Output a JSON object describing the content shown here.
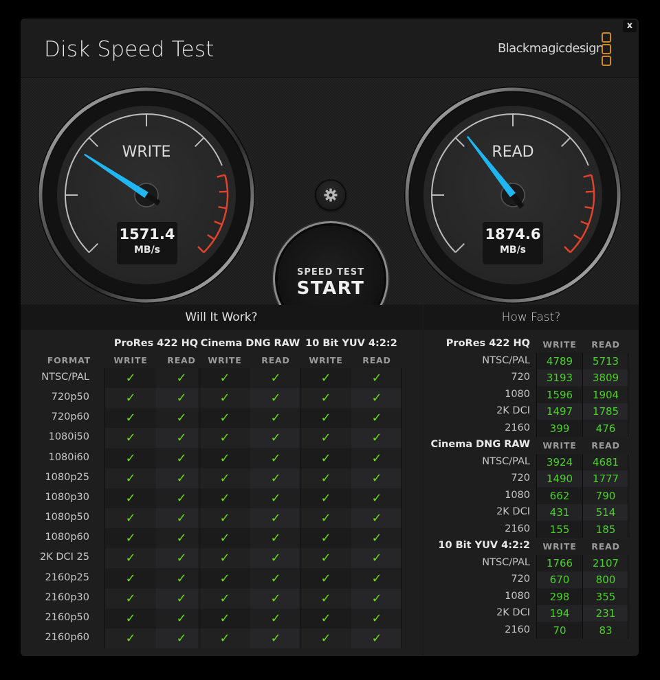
{
  "window": {
    "title": "Disk Speed Test",
    "brand": "Blackmagicdesign",
    "close_label": "x"
  },
  "gauges": {
    "write": {
      "label": "WRITE",
      "value": "1571.4",
      "unit": "MB/s",
      "needle_fraction": 0.29
    },
    "read": {
      "label": "READ",
      "value": "1874.6",
      "unit": "MB/s",
      "needle_fraction": 0.36
    }
  },
  "controls": {
    "settings_icon": "gear-icon",
    "start_line1": "SPEED TEST",
    "start_line2": "START"
  },
  "will_it_work": {
    "title": "Will It Work?",
    "format_header": "FORMAT",
    "codecs": [
      "ProRes 422 HQ",
      "Cinema DNG RAW",
      "10 Bit YUV 4:2:2"
    ],
    "subcols": [
      "WRITE",
      "READ"
    ],
    "check_glyph": "✓",
    "rows": [
      {
        "format": "NTSC/PAL",
        "results": [
          true,
          true,
          true,
          true,
          true,
          true
        ]
      },
      {
        "format": "720p50",
        "results": [
          true,
          true,
          true,
          true,
          true,
          true
        ]
      },
      {
        "format": "720p60",
        "results": [
          true,
          true,
          true,
          true,
          true,
          true
        ]
      },
      {
        "format": "1080i50",
        "results": [
          true,
          true,
          true,
          true,
          true,
          true
        ]
      },
      {
        "format": "1080i60",
        "results": [
          true,
          true,
          true,
          true,
          true,
          true
        ]
      },
      {
        "format": "1080p25",
        "results": [
          true,
          true,
          true,
          true,
          true,
          true
        ]
      },
      {
        "format": "1080p30",
        "results": [
          true,
          true,
          true,
          true,
          true,
          true
        ]
      },
      {
        "format": "1080p50",
        "results": [
          true,
          true,
          true,
          true,
          true,
          true
        ]
      },
      {
        "format": "1080p60",
        "results": [
          true,
          true,
          true,
          true,
          true,
          true
        ]
      },
      {
        "format": "2K DCI 25",
        "results": [
          true,
          true,
          true,
          true,
          true,
          true
        ]
      },
      {
        "format": "2160p25",
        "results": [
          true,
          true,
          true,
          true,
          true,
          true
        ]
      },
      {
        "format": "2160p30",
        "results": [
          true,
          true,
          true,
          true,
          true,
          true
        ]
      },
      {
        "format": "2160p50",
        "results": [
          true,
          true,
          true,
          true,
          true,
          true
        ]
      },
      {
        "format": "2160p60",
        "results": [
          true,
          true,
          true,
          true,
          true,
          true
        ]
      }
    ]
  },
  "how_fast": {
    "title": "How Fast?",
    "write_header": "WRITE",
    "read_header": "READ",
    "groups": [
      {
        "codec": "ProRes 422 HQ",
        "rows": [
          {
            "format": "NTSC/PAL",
            "write": "4789",
            "read": "5713"
          },
          {
            "format": "720",
            "write": "3193",
            "read": "3809"
          },
          {
            "format": "1080",
            "write": "1596",
            "read": "1904"
          },
          {
            "format": "2K DCI",
            "write": "1497",
            "read": "1785"
          },
          {
            "format": "2160",
            "write": "399",
            "read": "476"
          }
        ]
      },
      {
        "codec": "Cinema DNG RAW",
        "rows": [
          {
            "format": "NTSC/PAL",
            "write": "3924",
            "read": "4681"
          },
          {
            "format": "720",
            "write": "1490",
            "read": "1777"
          },
          {
            "format": "1080",
            "write": "662",
            "read": "790"
          },
          {
            "format": "2K DCI",
            "write": "431",
            "read": "514"
          },
          {
            "format": "2160",
            "write": "155",
            "read": "185"
          }
        ]
      },
      {
        "codec": "10 Bit YUV 4:2:2",
        "rows": [
          {
            "format": "NTSC/PAL",
            "write": "1766",
            "read": "2107"
          },
          {
            "format": "720",
            "write": "670",
            "read": "800"
          },
          {
            "format": "1080",
            "write": "298",
            "read": "355"
          },
          {
            "format": "2K DCI",
            "write": "194",
            "read": "231"
          },
          {
            "format": "2160",
            "write": "70",
            "read": "83"
          }
        ]
      }
    ]
  },
  "colors": {
    "needle": "#1fb6f2",
    "redline": "#e0432c",
    "check": "#6ad917",
    "value_green": "#4bd12a",
    "brand_orange": "#d08a23"
  }
}
